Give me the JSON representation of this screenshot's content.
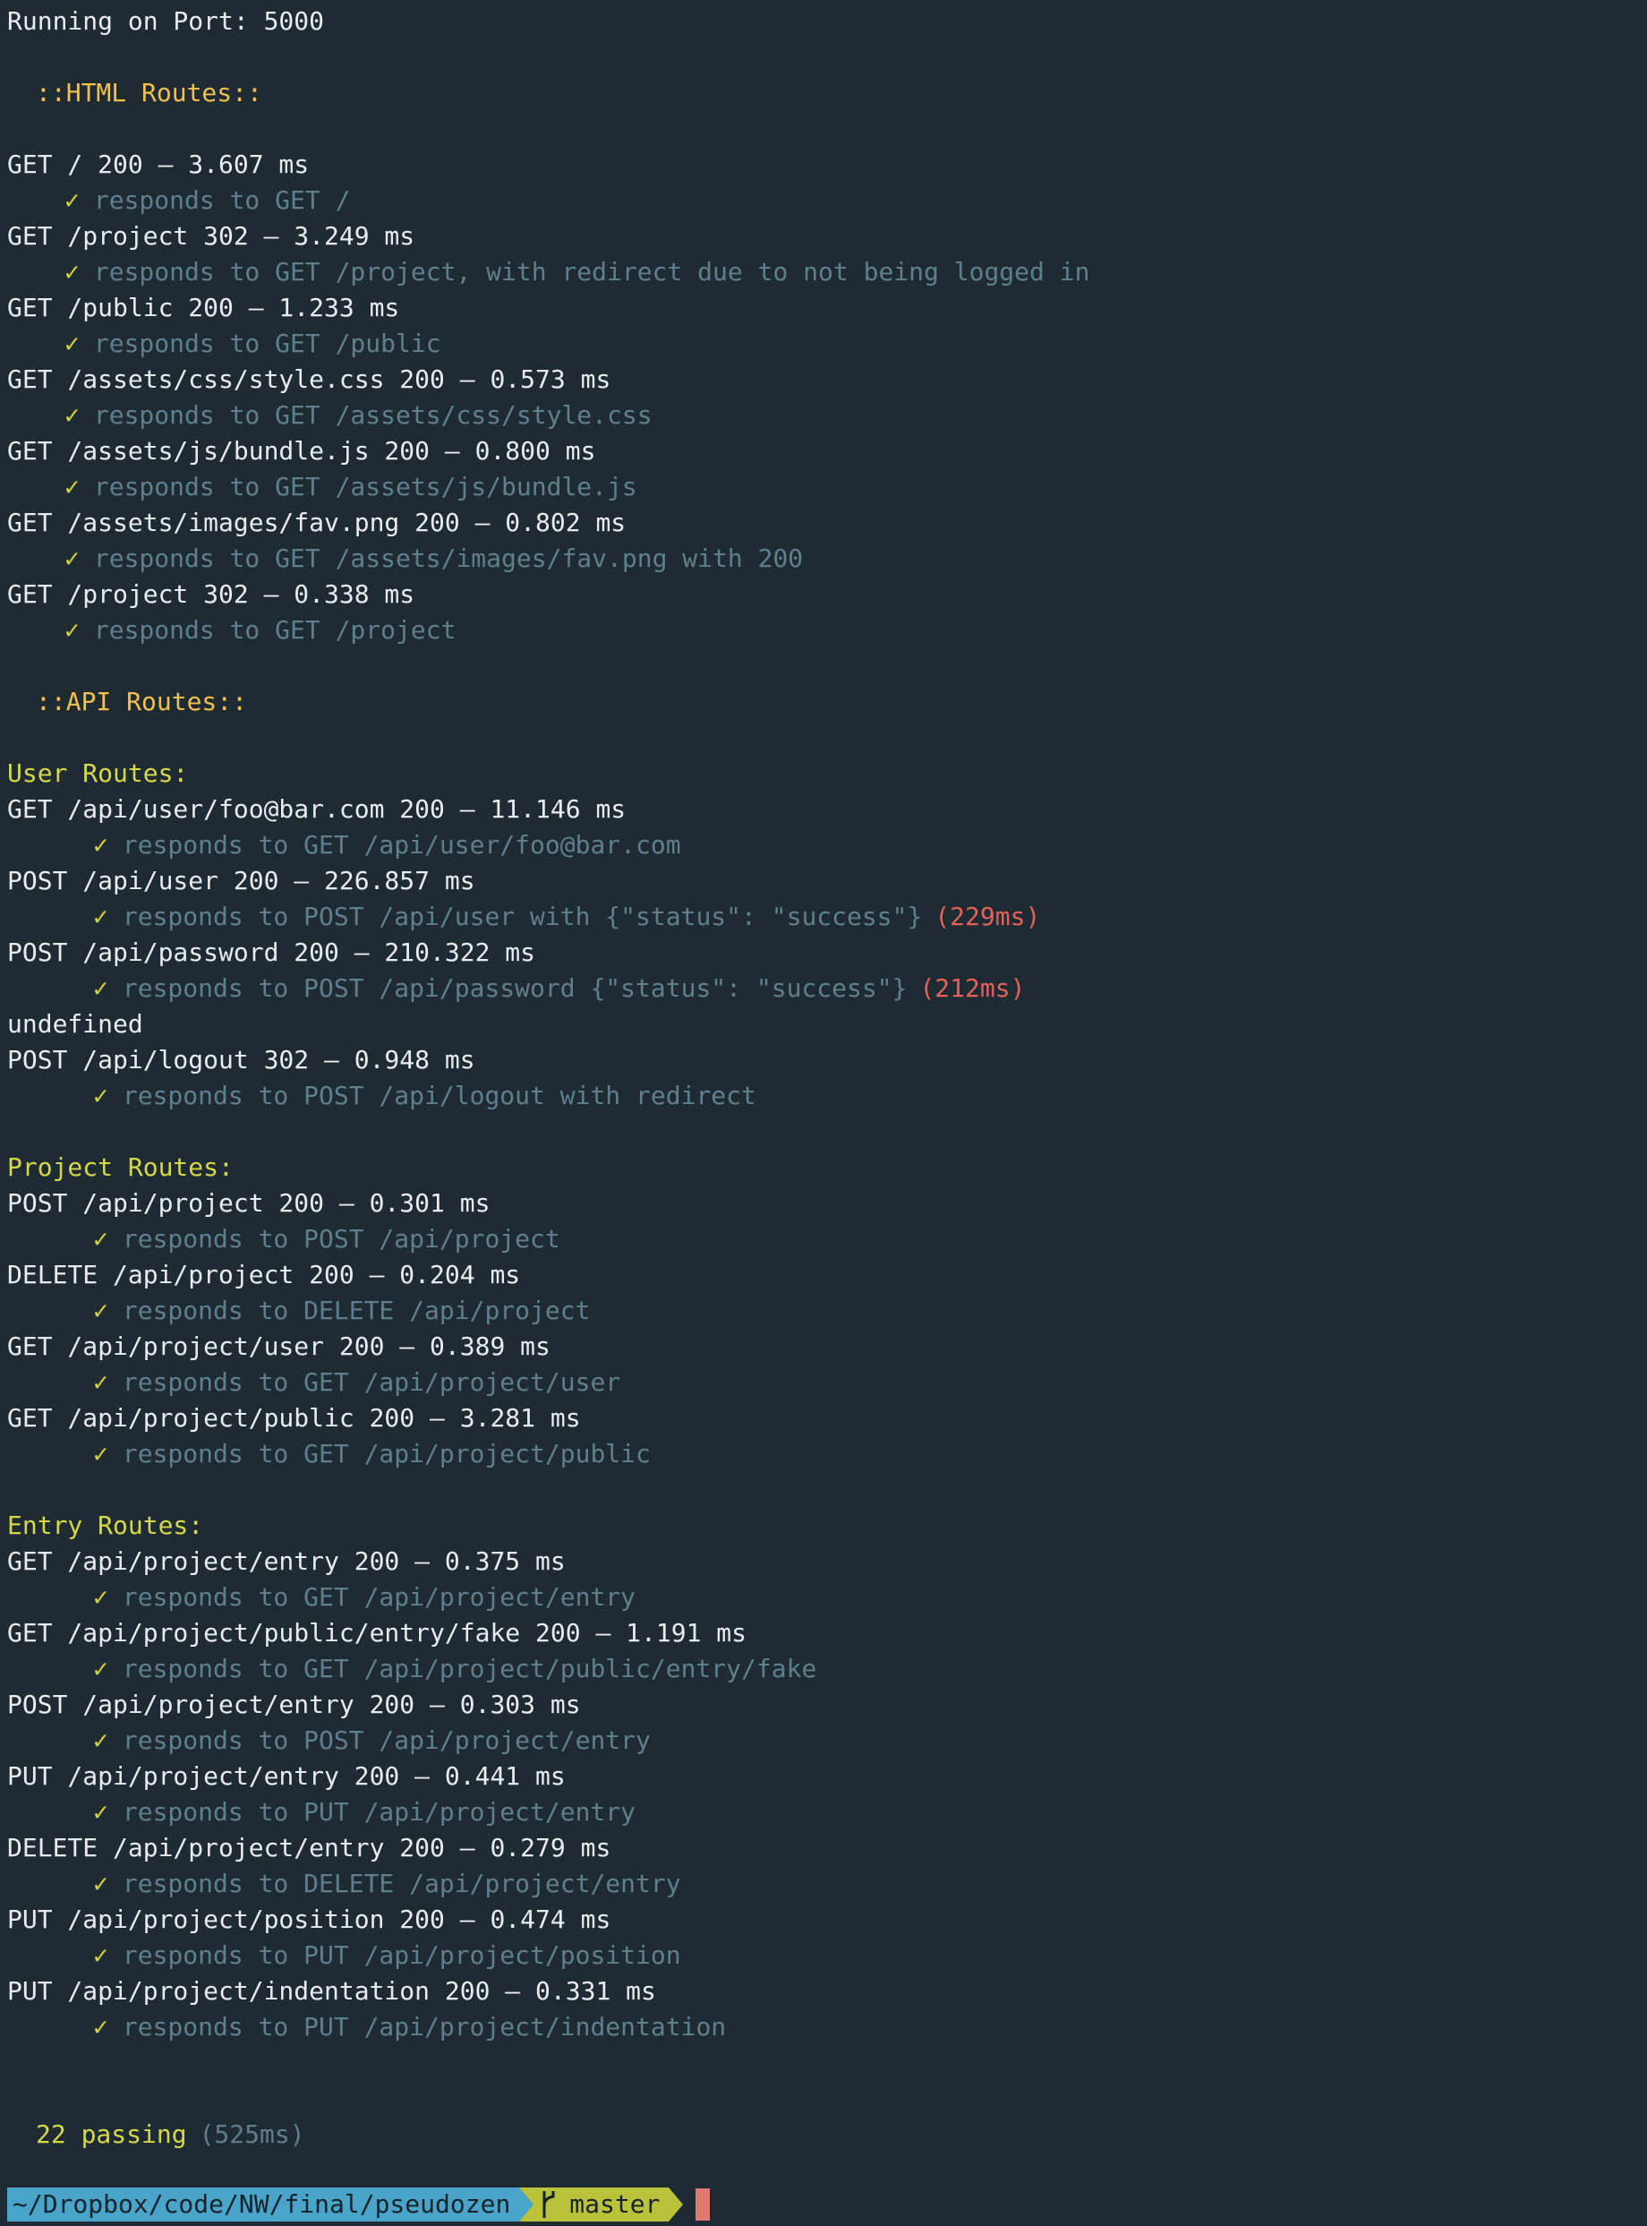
{
  "header": {
    "port_line": "Running on Port: 5000"
  },
  "sections": {
    "html_title": "::HTML Routes::",
    "api_title": "::API Routes::"
  },
  "check_glyph": "✓",
  "html_routes": [
    {
      "request": "GET / 200 – 3.607 ms",
      "test": "responds to GET /"
    },
    {
      "request": "GET /project 302 – 3.249 ms",
      "test": "responds to GET /project, with redirect due to not being logged in"
    },
    {
      "request": "GET /public 200 – 1.233 ms",
      "test": "responds to GET /public"
    },
    {
      "request": "GET /assets/css/style.css 200 – 0.573 ms",
      "test": "responds to GET /assets/css/style.css"
    },
    {
      "request": "GET /assets/js/bundle.js 200 – 0.800 ms",
      "test": "responds to GET /assets/js/bundle.js"
    },
    {
      "request": "GET /assets/images/fav.png 200 – 0.802 ms",
      "test": "responds to GET /assets/images/fav.png with 200"
    },
    {
      "request": "GET /project 302 – 0.338 ms",
      "test": "responds to GET /project"
    }
  ],
  "user_routes": {
    "title": "User Routes:",
    "items": [
      {
        "request": "GET /api/user/foo@bar.com 200 – 11.146 ms",
        "test": "responds to GET /api/user/foo@bar.com"
      },
      {
        "request": "POST /api/user 200 – 226.857 ms",
        "test": "responds to POST /api/user with {\"status\": \"success\"}",
        "slow": "(229ms)"
      },
      {
        "request": "POST /api/password 200 – 210.322 ms",
        "test": "responds to POST /api/password {\"status\": \"success\"}",
        "slow": "(212ms)"
      }
    ],
    "undefined_line": "undefined",
    "logout": {
      "request": "POST /api/logout 302 – 0.948 ms",
      "test": "responds to POST /api/logout with redirect"
    }
  },
  "project_routes": {
    "title": "Project Routes:",
    "items": [
      {
        "request": "POST /api/project 200 – 0.301 ms",
        "test": "responds to POST /api/project"
      },
      {
        "request": "DELETE /api/project 200 – 0.204 ms",
        "test": "responds to DELETE /api/project"
      },
      {
        "request": "GET /api/project/user 200 – 0.389 ms",
        "test": "responds to GET /api/project/user"
      },
      {
        "request": "GET /api/project/public 200 – 3.281 ms",
        "test": "responds to GET /api/project/public"
      }
    ]
  },
  "entry_routes": {
    "title": "Entry Routes:",
    "items": [
      {
        "request": "GET /api/project/entry 200 – 0.375 ms",
        "test": "responds to GET /api/project/entry"
      },
      {
        "request": "GET /api/project/public/entry/fake 200 – 1.191 ms",
        "test": "responds to GET /api/project/public/entry/fake"
      },
      {
        "request": "POST /api/project/entry 200 – 0.303 ms",
        "test": "responds to POST /api/project/entry"
      },
      {
        "request": "PUT /api/project/entry 200 – 0.441 ms",
        "test": "responds to PUT /api/project/entry"
      },
      {
        "request": "DELETE /api/project/entry 200 – 0.279 ms",
        "test": "responds to DELETE /api/project/entry"
      },
      {
        "request": "PUT /api/project/position 200 – 0.474 ms",
        "test": "responds to PUT /api/project/position"
      },
      {
        "request": "PUT /api/project/indentation 200 – 0.331 ms",
        "test": "responds to PUT /api/project/indentation"
      }
    ]
  },
  "summary": {
    "passing": "22 passing",
    "duration": "(525ms)"
  },
  "prompt": {
    "path": "~/Dropbox/code/NW/final/pseudozen",
    "branch": "master",
    "branch_icon": "git-branch-icon"
  },
  "colors": {
    "background": "#1f2b33",
    "text": "#e8ecef",
    "section": "#f1c04e",
    "group": "#d6d84a",
    "test": "#607f8c",
    "slow": "#e0625a",
    "prompt_path_bg": "#4aa3c8",
    "prompt_branch_bg": "#b9c23a",
    "cursor": "#e07a70"
  }
}
